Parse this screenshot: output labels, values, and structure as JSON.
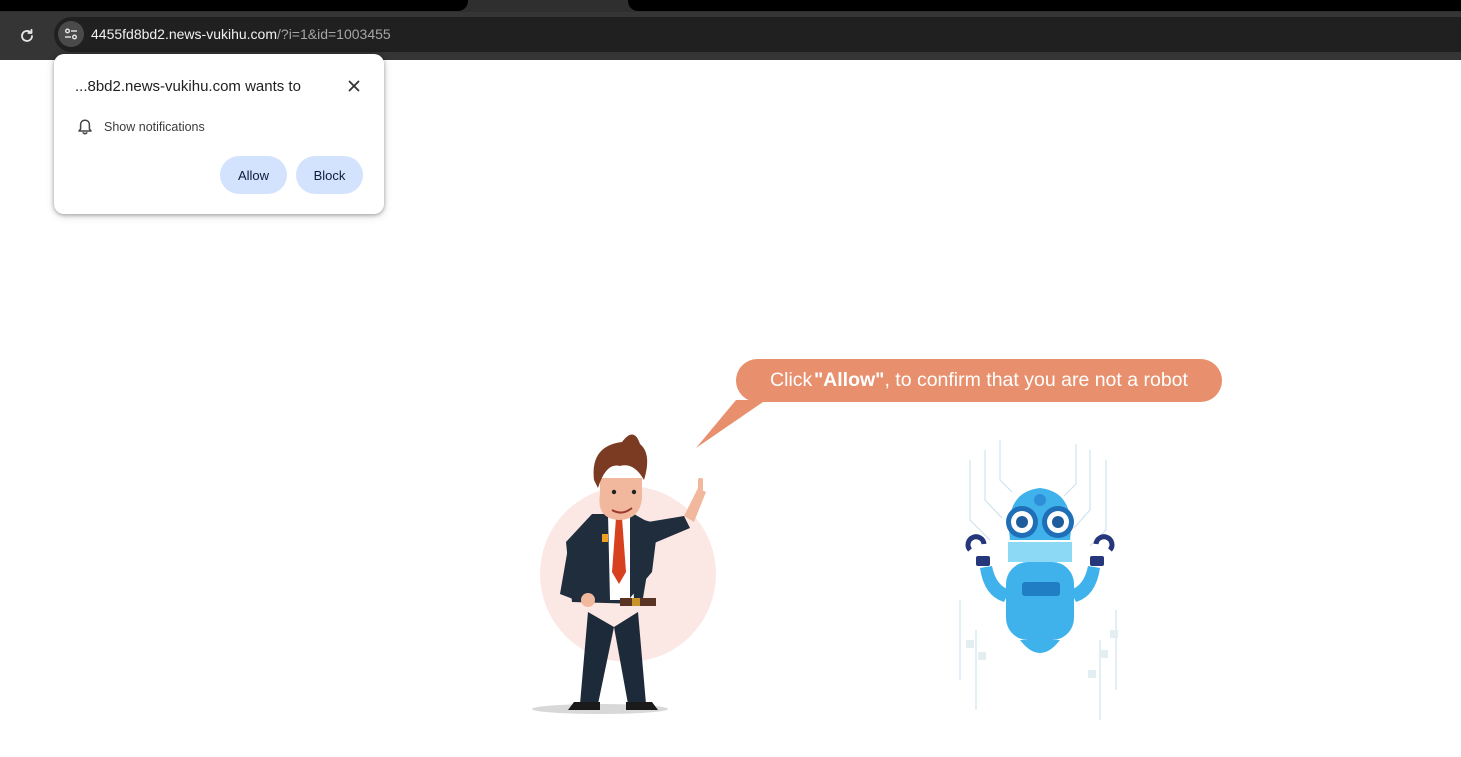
{
  "browser": {
    "url_host": "4455fd8bd2.news-vukihu.com",
    "url_path": "/?i=1&id=1003455",
    "reload_icon": "reload-icon",
    "site_info_icon": "tune-icon"
  },
  "permission_prompt": {
    "title": "...8bd2.news-vukihu.com wants to",
    "permission_label": "Show notifications",
    "permission_icon": "bell-icon",
    "allow_label": "Allow",
    "block_label": "Block",
    "close_icon": "close-icon"
  },
  "page": {
    "bubble_prefix": "Click ",
    "bubble_strong": "\"Allow\"",
    "bubble_suffix": ", to confirm that you are not a robot",
    "bubble_color": "#e8906d"
  }
}
